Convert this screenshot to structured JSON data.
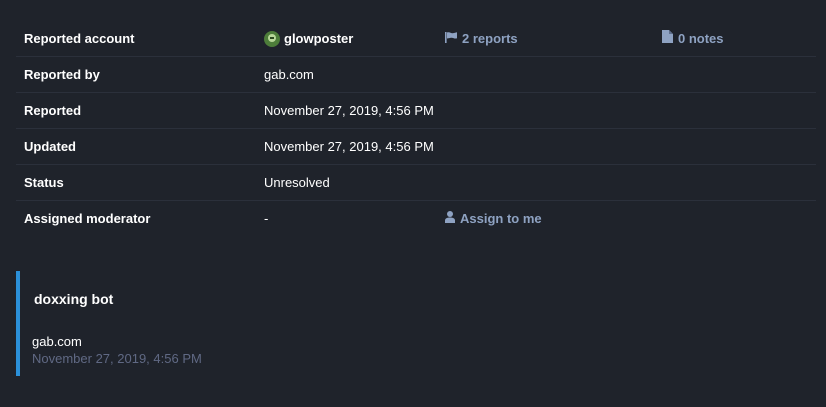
{
  "report": {
    "rows": [
      {
        "label": "Reported account",
        "value": "glowposter",
        "reports_link": "2 reports",
        "notes_link": "0 notes"
      },
      {
        "label": "Reported by",
        "value": "gab.com"
      },
      {
        "label": "Reported",
        "value": "November 27, 2019, 4:56 PM"
      },
      {
        "label": "Updated",
        "value": "November 27, 2019, 4:56 PM"
      },
      {
        "label": "Status",
        "value": "Unresolved"
      },
      {
        "label": "Assigned moderator",
        "value": "-",
        "assign_link": "Assign to me"
      }
    ]
  },
  "note": {
    "title": "doxxing bot",
    "author": "gab.com",
    "date": "November 27, 2019, 4:56 PM"
  },
  "colors": {
    "background": "#1f232b",
    "link": "#8ea2c2",
    "accent": "#2b90d9",
    "muted": "#606984"
  },
  "icons": {
    "reports": "flag-icon",
    "notes": "file-icon",
    "assign": "user-icon",
    "account": "avatar-icon"
  }
}
